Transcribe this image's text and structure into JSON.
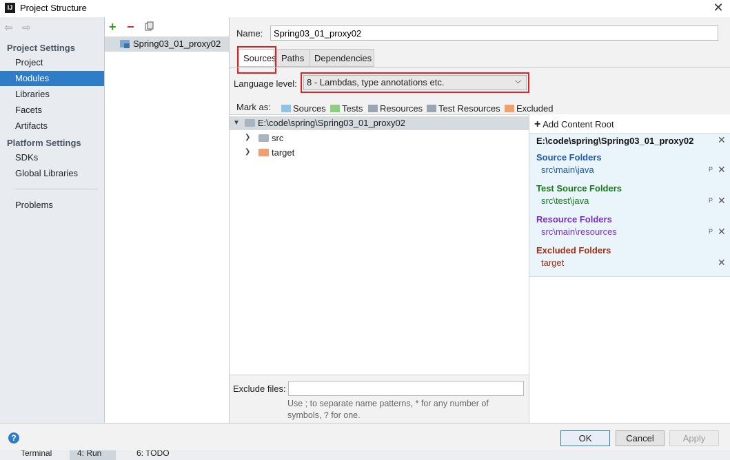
{
  "window": {
    "title": "Project Structure",
    "app_icon": "IJ"
  },
  "nav": {
    "back_icon": "arrow-left-icon",
    "forward_icon": "arrow-right-icon",
    "project_settings_header": "Project Settings",
    "project_settings": [
      "Project",
      "Modules",
      "Libraries",
      "Facets",
      "Artifacts"
    ],
    "platform_settings_header": "Platform Settings",
    "platform_settings": [
      "SDKs",
      "Global Libraries"
    ],
    "problems": "Problems",
    "selected": "Modules"
  },
  "modules": {
    "add": "+",
    "remove": "−",
    "items": [
      "Spring03_01_proxy02"
    ]
  },
  "main": {
    "name_label": "Name:",
    "name_value": "Spring03_01_proxy02",
    "tabs": [
      "Sources",
      "Paths",
      "Dependencies"
    ],
    "language_label": "Language level:",
    "language_value": "8 - Lambdas, type annotations etc.",
    "mark_as_label": "Mark as:",
    "mark_as": [
      {
        "label": "Sources",
        "color": "#8fc3e6"
      },
      {
        "label": "Tests",
        "color": "#8ccf7e"
      },
      {
        "label": "Resources",
        "color": "#9aa6b2"
      },
      {
        "label": "Test Resources",
        "color": "#9aa6b2"
      },
      {
        "label": "Excluded",
        "color": "#f0a070"
      }
    ],
    "tree": {
      "root": "E:\\code\\spring\\Spring03_01_proxy02",
      "children": [
        {
          "label": "src",
          "color": "#a9b4bf"
        },
        {
          "label": "target",
          "color": "#f0a070"
        }
      ]
    },
    "exclude_label": "Exclude files:",
    "exclude_hint": "Use ; to separate name patterns, * for any number of symbols, ? for one."
  },
  "roots": {
    "add_label": "Add Content Root",
    "root_path": "E:\\code\\spring\\Spring03_01_proxy02",
    "groups": [
      {
        "title": "Source Folders",
        "path": "src\\main\\java",
        "color": "#1e5aa8",
        "props": "P"
      },
      {
        "title": "Test Source Folders",
        "path": "src\\test\\java",
        "color": "#1a7a1a",
        "props": "P"
      },
      {
        "title": "Resource Folders",
        "path": "src\\main\\resources",
        "color": "#7a2fc7",
        "props": "P"
      },
      {
        "title": "Excluded Folders",
        "path": "target",
        "color": "#a03010",
        "props": ""
      }
    ]
  },
  "buttons": {
    "ok": "OK",
    "cancel": "Cancel",
    "apply": "Apply",
    "help": "?"
  },
  "taskbar": [
    "Terminal",
    "4: Run",
    "6: TODO"
  ]
}
